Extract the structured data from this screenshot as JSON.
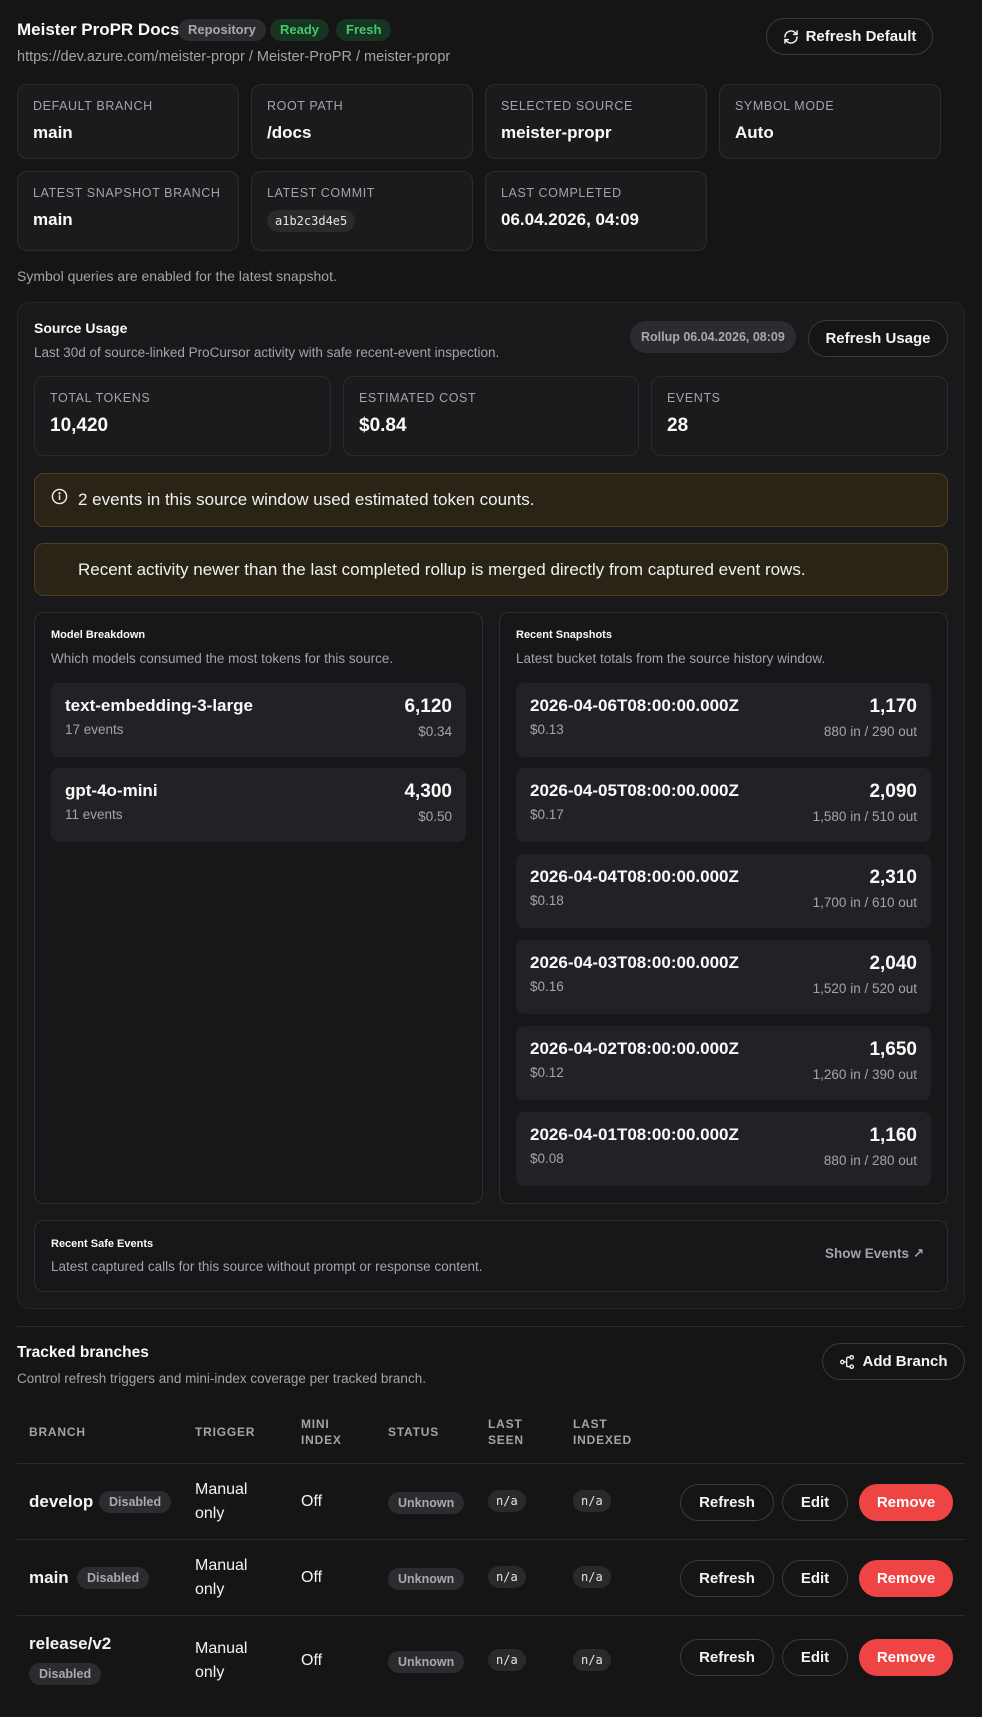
{
  "header": {
    "title": "Meister ProPR Docs",
    "badges": [
      "Repository",
      "Ready",
      "Fresh"
    ],
    "url": "https://dev.azure.com/meister-propr / Meister-ProPR / meister-propr",
    "refresh_default": "Refresh Default"
  },
  "info_cards": [
    {
      "label": "Default Branch",
      "value": "main"
    },
    {
      "label": "Root Path",
      "value": "/docs"
    },
    {
      "label": "Selected Source",
      "value": "meister-propr"
    },
    {
      "label": "Symbol Mode",
      "value": "Auto"
    },
    {
      "label": "Latest Snapshot Branch",
      "value": "main"
    },
    {
      "label": "Latest Commit",
      "value": "a1b2c3d4e5"
    },
    {
      "label": "Last Completed",
      "value": "06.04.2026, 04:09"
    }
  ],
  "symbol_note": "Symbol queries are enabled for the latest snapshot.",
  "source_usage": {
    "title": "Source Usage",
    "subtitle": "Last 30d of source-linked ProCursor activity with safe recent-event inspection.",
    "rollup": "Rollup 06.04.2026, 08:09",
    "refresh_usage": "Refresh Usage",
    "stats": [
      {
        "label": "Total Tokens",
        "value": "10,420"
      },
      {
        "label": "Estimated Cost",
        "value": "$0.84"
      },
      {
        "label": "Events",
        "value": "28"
      }
    ],
    "alert1": "2 events in this source window used estimated token counts.",
    "alert2": "Recent activity newer than the last completed rollup is merged directly from captured event rows.",
    "model_breakdown": {
      "title": "Model Breakdown",
      "subtitle": "Which models consumed the most tokens for this source.",
      "items": [
        {
          "name": "text-embedding-3-large",
          "events": "17 events",
          "tokens": "6,120",
          "cost": "$0.34"
        },
        {
          "name": "gpt-4o-mini",
          "events": "11 events",
          "tokens": "4,300",
          "cost": "$0.50"
        }
      ]
    },
    "recent_snapshots": {
      "title": "Recent Snapshots",
      "subtitle": "Latest bucket totals from the source history window.",
      "items": [
        {
          "date": "2026-04-06T08:00:00.000Z",
          "cost": "$0.13",
          "total": "1,170",
          "io": "880 in / 290 out"
        },
        {
          "date": "2026-04-05T08:00:00.000Z",
          "cost": "$0.17",
          "total": "2,090",
          "io": "1,580 in / 510 out"
        },
        {
          "date": "2026-04-04T08:00:00.000Z",
          "cost": "$0.18",
          "total": "2,310",
          "io": "1,700 in / 610 out"
        },
        {
          "date": "2026-04-03T08:00:00.000Z",
          "cost": "$0.16",
          "total": "2,040",
          "io": "1,520 in / 520 out"
        },
        {
          "date": "2026-04-02T08:00:00.000Z",
          "cost": "$0.12",
          "total": "1,650",
          "io": "1,260 in / 390 out"
        },
        {
          "date": "2026-04-01T08:00:00.000Z",
          "cost": "$0.08",
          "total": "1,160",
          "io": "880 in / 280 out"
        }
      ]
    },
    "safe_events": {
      "title": "Recent Safe Events",
      "subtitle": "Latest captured calls for this source without prompt or response content.",
      "show": "Show Events ↗"
    }
  },
  "tracked": {
    "title": "Tracked branches",
    "subtitle": "Control refresh triggers and mini-index coverage per tracked branch.",
    "add_branch": "Add Branch",
    "columns": [
      "BRANCH",
      "TRIGGER",
      "MINI INDEX",
      "STATUS",
      "LAST SEEN",
      "LAST INDEXED"
    ],
    "rows": [
      {
        "branch": "develop",
        "badge": "Disabled",
        "trigger": "Manual only",
        "mini": "Off",
        "status": "Unknown",
        "seen": "n/a",
        "indexed": "n/a"
      },
      {
        "branch": "main",
        "badge": "Disabled",
        "trigger": "Manual only",
        "mini": "Off",
        "status": "Unknown",
        "seen": "n/a",
        "indexed": "n/a"
      },
      {
        "branch": "release/v2",
        "badge": "Disabled",
        "trigger": "Manual only",
        "mini": "Off",
        "status": "Unknown",
        "seen": "n/a",
        "indexed": "n/a"
      }
    ],
    "actions": {
      "refresh": "Refresh",
      "edit": "Edit",
      "remove": "Remove"
    }
  }
}
